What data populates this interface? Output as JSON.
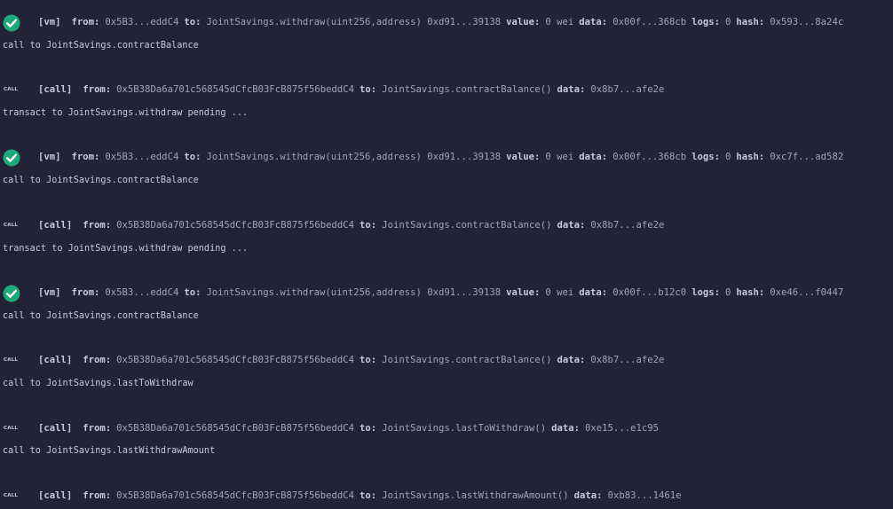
{
  "icons": {
    "success": "check-circle-icon",
    "call": "call-badge-icon"
  },
  "colors": {
    "background": "#222336",
    "success_green": "#1ea97c",
    "text": "#a2a3bd",
    "text_bold": "#c8c9dc"
  },
  "entries": [
    {
      "kind": "[vm]",
      "from": "0x5B3...eddC4",
      "to": "JointSavings.withdraw(uint256,address) 0xd91...39138",
      "value": "0 wei",
      "data": "0x00f...368cb",
      "logs": "0",
      "hash": "0x593...8a24c"
    },
    {
      "message": "call to JointSavings.contractBalance"
    },
    {
      "kind": "[call]",
      "from": "0x5B38Da6a701c568545dCfcB03FcB875f56beddC4",
      "to": "JointSavings.contractBalance()",
      "data": "0x8b7...afe2e"
    },
    {
      "message": "transact to JointSavings.withdraw pending ..."
    },
    {
      "kind": "[vm]",
      "from": "0x5B3...eddC4",
      "to": "JointSavings.withdraw(uint256,address) 0xd91...39138",
      "value": "0 wei",
      "data": "0x00f...368cb",
      "logs": "0",
      "hash": "0xc7f...ad582"
    },
    {
      "message": "call to JointSavings.contractBalance"
    },
    {
      "kind": "[call]",
      "from": "0x5B38Da6a701c568545dCfcB03FcB875f56beddC4",
      "to": "JointSavings.contractBalance()",
      "data": "0x8b7...afe2e"
    },
    {
      "message": "transact to JointSavings.withdraw pending ..."
    },
    {
      "kind": "[vm]",
      "from": "0x5B3...eddC4",
      "to": "JointSavings.withdraw(uint256,address) 0xd91...39138",
      "value": "0 wei",
      "data": "0x00f...b12c0",
      "logs": "0",
      "hash": "0xe46...f0447"
    },
    {
      "message": "call to JointSavings.contractBalance"
    },
    {
      "kind": "[call]",
      "from": "0x5B38Da6a701c568545dCfcB03FcB875f56beddC4",
      "to": "JointSavings.contractBalance()",
      "data": "0x8b7...afe2e"
    },
    {
      "message": "call to JointSavings.lastToWithdraw"
    },
    {
      "kind": "[call]",
      "from": "0x5B38Da6a701c568545dCfcB03FcB875f56beddC4",
      "to": "JointSavings.lastToWithdraw()",
      "data": "0xe15...e1c95"
    },
    {
      "message": "call to JointSavings.lastWithdrawAmount"
    },
    {
      "kind": "[call]",
      "from": "0x5B38Da6a701c568545dCfcB03FcB875f56beddC4",
      "to": "JointSavings.lastWithdrawAmount()",
      "data": "0xb83...1461e"
    }
  ],
  "labels": {
    "from": "from:",
    "to": "to:",
    "value": "value:",
    "data": "data:",
    "logs": "logs:",
    "hash": "hash:",
    "call_badge": "CALL"
  }
}
